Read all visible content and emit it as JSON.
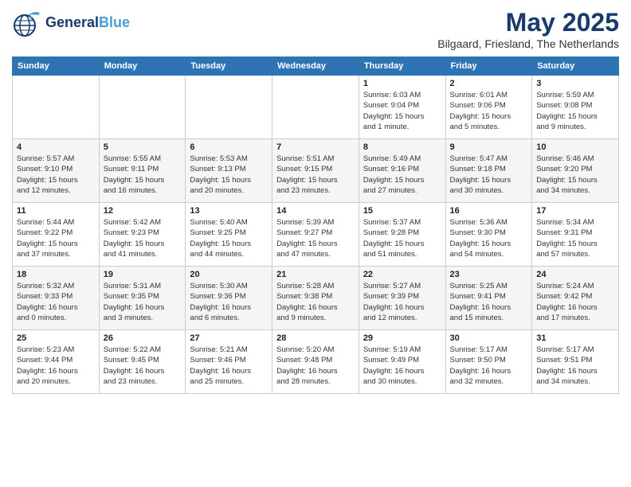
{
  "header": {
    "logo_line1": "General",
    "logo_line2": "Blue",
    "month_title": "May 2025",
    "location": "Bilgaard, Friesland, The Netherlands"
  },
  "days_of_week": [
    "Sunday",
    "Monday",
    "Tuesday",
    "Wednesday",
    "Thursday",
    "Friday",
    "Saturday"
  ],
  "weeks": [
    [
      {
        "day": "",
        "info": ""
      },
      {
        "day": "",
        "info": ""
      },
      {
        "day": "",
        "info": ""
      },
      {
        "day": "",
        "info": ""
      },
      {
        "day": "1",
        "info": "Sunrise: 6:03 AM\nSunset: 9:04 PM\nDaylight: 15 hours\nand 1 minute."
      },
      {
        "day": "2",
        "info": "Sunrise: 6:01 AM\nSunset: 9:06 PM\nDaylight: 15 hours\nand 5 minutes."
      },
      {
        "day": "3",
        "info": "Sunrise: 5:59 AM\nSunset: 9:08 PM\nDaylight: 15 hours\nand 9 minutes."
      }
    ],
    [
      {
        "day": "4",
        "info": "Sunrise: 5:57 AM\nSunset: 9:10 PM\nDaylight: 15 hours\nand 12 minutes."
      },
      {
        "day": "5",
        "info": "Sunrise: 5:55 AM\nSunset: 9:11 PM\nDaylight: 15 hours\nand 16 minutes."
      },
      {
        "day": "6",
        "info": "Sunrise: 5:53 AM\nSunset: 9:13 PM\nDaylight: 15 hours\nand 20 minutes."
      },
      {
        "day": "7",
        "info": "Sunrise: 5:51 AM\nSunset: 9:15 PM\nDaylight: 15 hours\nand 23 minutes."
      },
      {
        "day": "8",
        "info": "Sunrise: 5:49 AM\nSunset: 9:16 PM\nDaylight: 15 hours\nand 27 minutes."
      },
      {
        "day": "9",
        "info": "Sunrise: 5:47 AM\nSunset: 9:18 PM\nDaylight: 15 hours\nand 30 minutes."
      },
      {
        "day": "10",
        "info": "Sunrise: 5:46 AM\nSunset: 9:20 PM\nDaylight: 15 hours\nand 34 minutes."
      }
    ],
    [
      {
        "day": "11",
        "info": "Sunrise: 5:44 AM\nSunset: 9:22 PM\nDaylight: 15 hours\nand 37 minutes."
      },
      {
        "day": "12",
        "info": "Sunrise: 5:42 AM\nSunset: 9:23 PM\nDaylight: 15 hours\nand 41 minutes."
      },
      {
        "day": "13",
        "info": "Sunrise: 5:40 AM\nSunset: 9:25 PM\nDaylight: 15 hours\nand 44 minutes."
      },
      {
        "day": "14",
        "info": "Sunrise: 5:39 AM\nSunset: 9:27 PM\nDaylight: 15 hours\nand 47 minutes."
      },
      {
        "day": "15",
        "info": "Sunrise: 5:37 AM\nSunset: 9:28 PM\nDaylight: 15 hours\nand 51 minutes."
      },
      {
        "day": "16",
        "info": "Sunrise: 5:36 AM\nSunset: 9:30 PM\nDaylight: 15 hours\nand 54 minutes."
      },
      {
        "day": "17",
        "info": "Sunrise: 5:34 AM\nSunset: 9:31 PM\nDaylight: 15 hours\nand 57 minutes."
      }
    ],
    [
      {
        "day": "18",
        "info": "Sunrise: 5:32 AM\nSunset: 9:33 PM\nDaylight: 16 hours\nand 0 minutes."
      },
      {
        "day": "19",
        "info": "Sunrise: 5:31 AM\nSunset: 9:35 PM\nDaylight: 16 hours\nand 3 minutes."
      },
      {
        "day": "20",
        "info": "Sunrise: 5:30 AM\nSunset: 9:36 PM\nDaylight: 16 hours\nand 6 minutes."
      },
      {
        "day": "21",
        "info": "Sunrise: 5:28 AM\nSunset: 9:38 PM\nDaylight: 16 hours\nand 9 minutes."
      },
      {
        "day": "22",
        "info": "Sunrise: 5:27 AM\nSunset: 9:39 PM\nDaylight: 16 hours\nand 12 minutes."
      },
      {
        "day": "23",
        "info": "Sunrise: 5:25 AM\nSunset: 9:41 PM\nDaylight: 16 hours\nand 15 minutes."
      },
      {
        "day": "24",
        "info": "Sunrise: 5:24 AM\nSunset: 9:42 PM\nDaylight: 16 hours\nand 17 minutes."
      }
    ],
    [
      {
        "day": "25",
        "info": "Sunrise: 5:23 AM\nSunset: 9:44 PM\nDaylight: 16 hours\nand 20 minutes."
      },
      {
        "day": "26",
        "info": "Sunrise: 5:22 AM\nSunset: 9:45 PM\nDaylight: 16 hours\nand 23 minutes."
      },
      {
        "day": "27",
        "info": "Sunrise: 5:21 AM\nSunset: 9:46 PM\nDaylight: 16 hours\nand 25 minutes."
      },
      {
        "day": "28",
        "info": "Sunrise: 5:20 AM\nSunset: 9:48 PM\nDaylight: 16 hours\nand 28 minutes."
      },
      {
        "day": "29",
        "info": "Sunrise: 5:19 AM\nSunset: 9:49 PM\nDaylight: 16 hours\nand 30 minutes."
      },
      {
        "day": "30",
        "info": "Sunrise: 5:17 AM\nSunset: 9:50 PM\nDaylight: 16 hours\nand 32 minutes."
      },
      {
        "day": "31",
        "info": "Sunrise: 5:17 AM\nSunset: 9:51 PM\nDaylight: 16 hours\nand 34 minutes."
      }
    ]
  ]
}
